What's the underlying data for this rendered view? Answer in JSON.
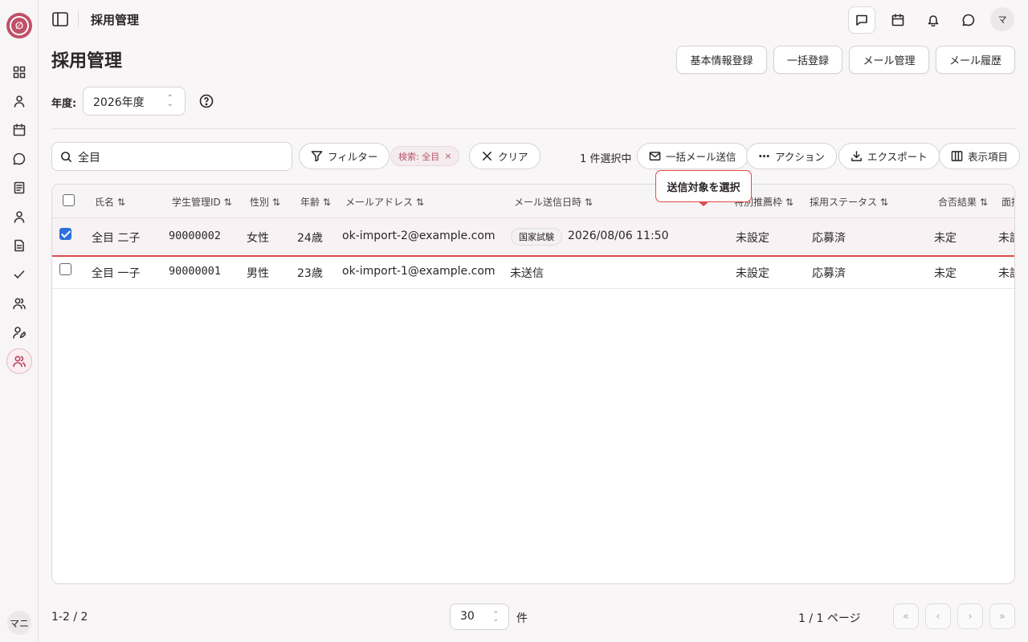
{
  "sidebar": {
    "logo_glyph": "∅",
    "items": [
      "dashboard-icon",
      "user-icon",
      "calendar-icon",
      "chat-icon",
      "document-icon",
      "person-icon",
      "file-icon",
      "check-icon",
      "users-icon",
      "user-edit-icon",
      "users-active-icon"
    ],
    "user_initials": "マニ"
  },
  "header": {
    "title": "採用管理",
    "avatar_initial": "マ"
  },
  "page": {
    "title": "採用管理",
    "buttons": [
      "基本情報登録",
      "一括登録",
      "メール管理",
      "メール履歴"
    ],
    "year_label": "年度:",
    "year_value": "2026年度"
  },
  "toolbar": {
    "search_value": "全目",
    "filter_label": "フィルター",
    "chip_label": "検索: 全目",
    "clear_label": "クリア",
    "selected_count": "1 件選択中",
    "bulk_mail_label": "一括メール送信",
    "action_label": "アクション",
    "export_label": "エクスポート",
    "columns_label": "表示項目"
  },
  "tooltip": {
    "text": "送信対象を選択"
  },
  "table": {
    "headers": {
      "name": "氏名 ⇅",
      "student_id": "学生管理ID ⇅",
      "gender": "性別 ⇅",
      "age": "年齢 ⇅",
      "email": "メールアドレス ⇅",
      "mail_date": "メール送信日時 ⇅",
      "recommendation": "特別推薦枠 ⇅",
      "status": "採用ステータス ⇅",
      "result": "合否結果 ⇅",
      "interview": "面接"
    },
    "rows": [
      {
        "checked": true,
        "name": "全目 二子",
        "student_id": "90000002",
        "gender": "女性",
        "age": "24歳",
        "email": "ok-import-2@example.com",
        "mail_badge": "国家試験",
        "mail_date": "2026/08/06 11:50",
        "recommendation": "未設定",
        "status": "応募済",
        "result": "未定",
        "interview": "未設"
      },
      {
        "checked": false,
        "name": "全目 一子",
        "student_id": "90000001",
        "gender": "男性",
        "age": "23歳",
        "email": "ok-import-1@example.com",
        "mail_badge": "",
        "mail_date": "未送信",
        "recommendation": "未設定",
        "status": "応募済",
        "result": "未定",
        "interview": "未設"
      }
    ]
  },
  "footer": {
    "range": "1-2 / 2",
    "page_size": "30",
    "unit": "件",
    "page_info": "1 / 1 ページ"
  },
  "colors": {
    "accent": "#c0506a",
    "highlight": "#e04b4b",
    "checkbox": "#2f6fdb"
  }
}
